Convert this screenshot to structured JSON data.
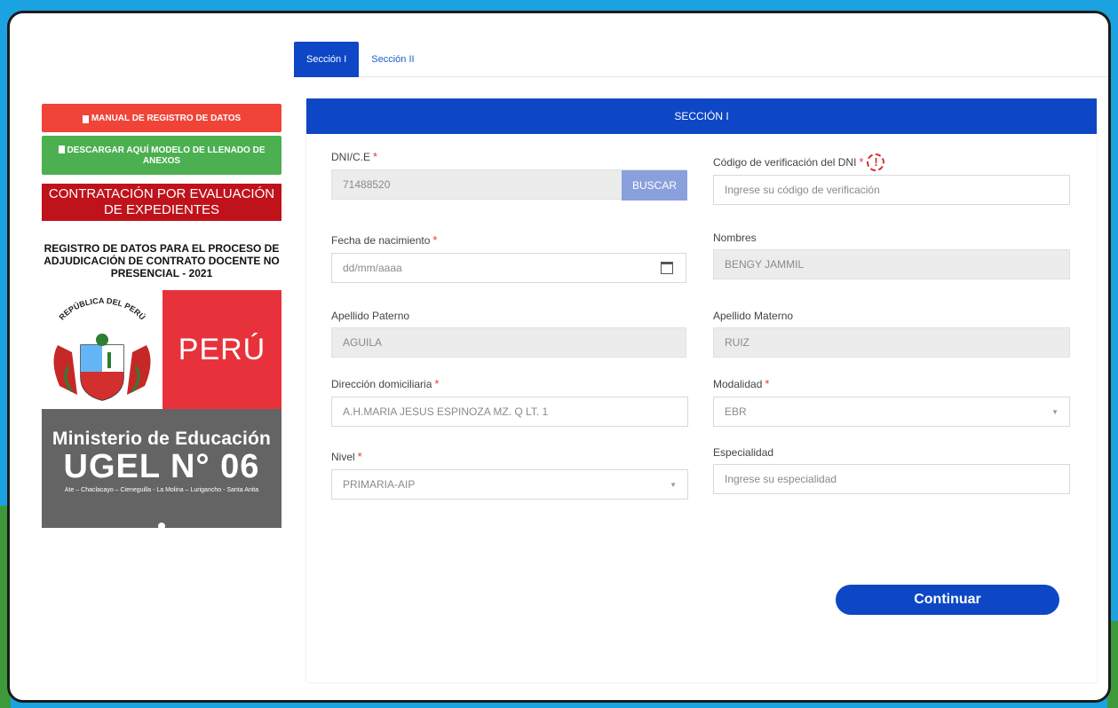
{
  "sidebar": {
    "manual_label": "MANUAL DE REGISTRO DE DATOS",
    "download_label": "DESCARGAR AQUÍ MODELO DE LLENADO DE ANEXOS",
    "banner": "CONTRATACIÓN POR EVALUACIÓN DE EXPEDIENTES",
    "register_title": "REGISTRO DE DATOS PARA EL PROCESO DE ADJUDICACIÓN DE CONTRATO DOCENTE NO PRESENCIAL - 2021",
    "logo": {
      "seal_text": "REPÚBLICA DEL PERÚ",
      "country": "PERÚ",
      "ministry": "Ministerio de Educación",
      "ugel": "UGEL N° 06",
      "districts": "Ate – Chaclacayo – Cieneguilla - La Molina – Lurigancho - Santa Anita"
    }
  },
  "tabs": [
    {
      "label": "Sección I",
      "active": true
    },
    {
      "label": "Sección II",
      "active": false
    }
  ],
  "form": {
    "header": "SECCIÓN I",
    "dni_label": "DNI/C.E",
    "dni_value": "71488520",
    "buscar_label": "BUSCAR",
    "verif_label": "Código de verificación del DNI",
    "verif_placeholder": "Ingrese su código de verificación",
    "birth_label": "Fecha de nacimiento",
    "birth_placeholder": "dd/mm/aaaa",
    "names_label": "Nombres",
    "names_value": "BENGY JAMMIL",
    "paterno_label": "Apellido Paterno",
    "paterno_value": "AGUILA",
    "materno_label": "Apellido Materno",
    "materno_value": "RUIZ",
    "address_label": "Dirección domiciliaria",
    "address_value": "A.H.MARIA JESUS ESPINOZA MZ. Q LT. 1",
    "modality_label": "Modalidad",
    "modality_value": "EBR",
    "level_label": "Nivel",
    "level_value": "PRIMARIA-AIP",
    "specialty_label": "Especialidad",
    "specialty_placeholder": "Ingrese su especialidad",
    "continue_label": "Continuar",
    "required_mark": "*",
    "warn_mark": "!"
  },
  "colors": {
    "primary": "#0d47c6",
    "manual_red": "#f04438",
    "download_green": "#4caf50",
    "banner_red": "#c0121b",
    "peru_red": "#e8323b",
    "ugel_gray": "#646464"
  }
}
